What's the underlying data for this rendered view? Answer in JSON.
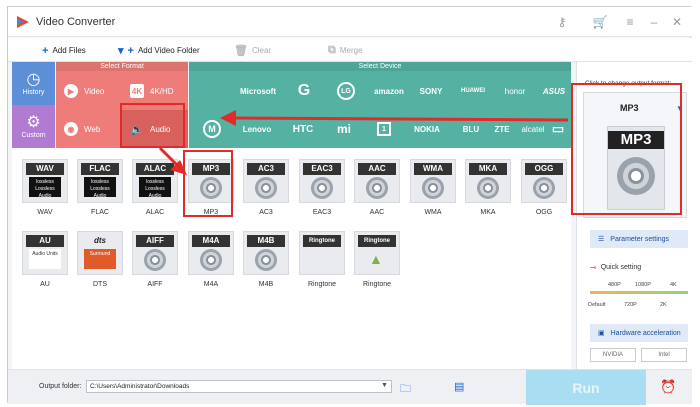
{
  "window": {
    "title": "Video Converter"
  },
  "toolbar": {
    "add_files": "Add Files",
    "add_video_folder": "Add Video Folder",
    "clear": "Clear",
    "merge": "Merge"
  },
  "category": {
    "history": "History",
    "custom": "Custom",
    "select_format": "Select Format",
    "select_device": "Select Device",
    "format_items": [
      {
        "label": "Video",
        "icon": "video-play-icon"
      },
      {
        "label": "4K/HD",
        "icon": "4k-icon"
      },
      {
        "label": "Web",
        "icon": "web-icon"
      },
      {
        "label": "Audio",
        "icon": "speaker-icon"
      }
    ],
    "brands_row1": [
      "",
      "Microsoft",
      "G",
      "LG",
      "amazon",
      "SONY",
      "HUAWEI",
      "honor",
      "ASUS"
    ],
    "brands_row2": [
      "",
      "Lenovo",
      "HTC",
      "mi",
      "",
      "NOKIA",
      "BLU",
      "ZTE",
      "alcatel",
      ""
    ]
  },
  "formats_row1": [
    {
      "label": "WAV",
      "sub": "lossless Lossless Audio",
      "name": "WAV"
    },
    {
      "label": "FLAC",
      "sub": "lossless Lossless Audio",
      "name": "FLAC"
    },
    {
      "label": "ALAC",
      "sub": "lossless Lossless Audio",
      "name": "ALAC"
    },
    {
      "label": "MP3",
      "sub": "",
      "name": "MP3"
    },
    {
      "label": "AC3",
      "sub": "",
      "name": "AC3"
    },
    {
      "label": "EAC3",
      "sub": "",
      "name": "EAC3"
    },
    {
      "label": "AAC",
      "sub": "",
      "name": "AAC"
    },
    {
      "label": "WMA",
      "sub": "",
      "name": "WMA"
    },
    {
      "label": "MKA",
      "sub": "",
      "name": "MKA"
    },
    {
      "label": "OGG",
      "sub": "",
      "name": "OGG"
    }
  ],
  "formats_row2": [
    {
      "label": "AU",
      "sub": "Audio Units",
      "name": "AU"
    },
    {
      "label": "dts",
      "sub": "Surround",
      "name": "DTS"
    },
    {
      "label": "AIFF",
      "sub": "",
      "name": "AIFF"
    },
    {
      "label": "M4A",
      "sub": "",
      "name": "M4A"
    },
    {
      "label": "M4B",
      "sub": "",
      "name": "M4B"
    },
    {
      "label": "Ringtone",
      "sub": "",
      "name": "Ringtone"
    },
    {
      "label": "Ringtone",
      "sub": "",
      "name": "Ringtone"
    }
  ],
  "output": {
    "hint": "Click to change output format:",
    "format": "MP3",
    "icon_label": "MP3",
    "parameter_settings": "Parameter settings",
    "quick_setting": "Quick setting",
    "slider_top": [
      "480P",
      "1080P",
      "4K"
    ],
    "slider_bottom": [
      "Default",
      "720P",
      "2K"
    ],
    "hardware_acceleration": "Hardware acceleration",
    "nvidia": "NVIDIA",
    "intel": "Intel"
  },
  "bottom": {
    "output_folder_label": "Output folder:",
    "output_folder_value": "C:\\Users\\Administrator\\Downloads",
    "run": "Run"
  },
  "colors": {
    "format_panel": "#ee7d79",
    "device_panel": "#55b2a3",
    "annotation_red": "#e12b2b",
    "run_button": "#a9ddf1"
  }
}
